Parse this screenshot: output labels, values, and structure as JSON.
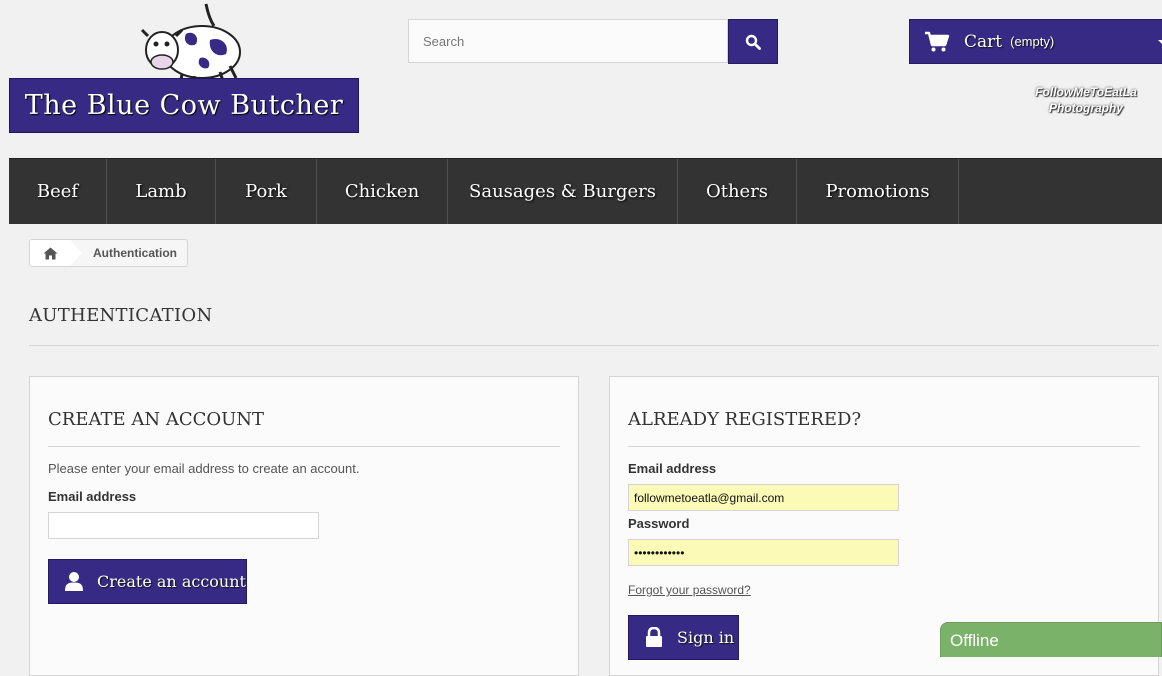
{
  "brand": {
    "name": "The Blue Cow Butcher"
  },
  "search": {
    "placeholder": "Search"
  },
  "cart": {
    "label": "Cart",
    "status": "(empty)"
  },
  "watermark": {
    "line1": "FollowMeToEatLa",
    "line2": "Photography"
  },
  "nav": [
    "Beef",
    "Lamb",
    "Pork",
    "Chicken",
    "Sausages & Burgers",
    "Others",
    "Promotions"
  ],
  "breadcrumb": {
    "current": "Authentication"
  },
  "page": {
    "heading": "AUTHENTICATION"
  },
  "create": {
    "title": "CREATE AN ACCOUNT",
    "intro": "Please enter your email address to create an account.",
    "email_label": "Email address",
    "email_value": "",
    "button": "Create an account"
  },
  "login": {
    "title": "ALREADY REGISTERED?",
    "email_label": "Email address",
    "email_value": "followmetoeatla@gmail.com",
    "password_label": "Password",
    "password_value": "••••••••••••",
    "forgot": "Forgot your password?",
    "button": "Sign in"
  },
  "chat": {
    "status": "Offline"
  },
  "colors": {
    "brand": "#362a84",
    "nav": "#333333",
    "chat": "#7bb26a",
    "autofill": "#fbfbb7"
  }
}
